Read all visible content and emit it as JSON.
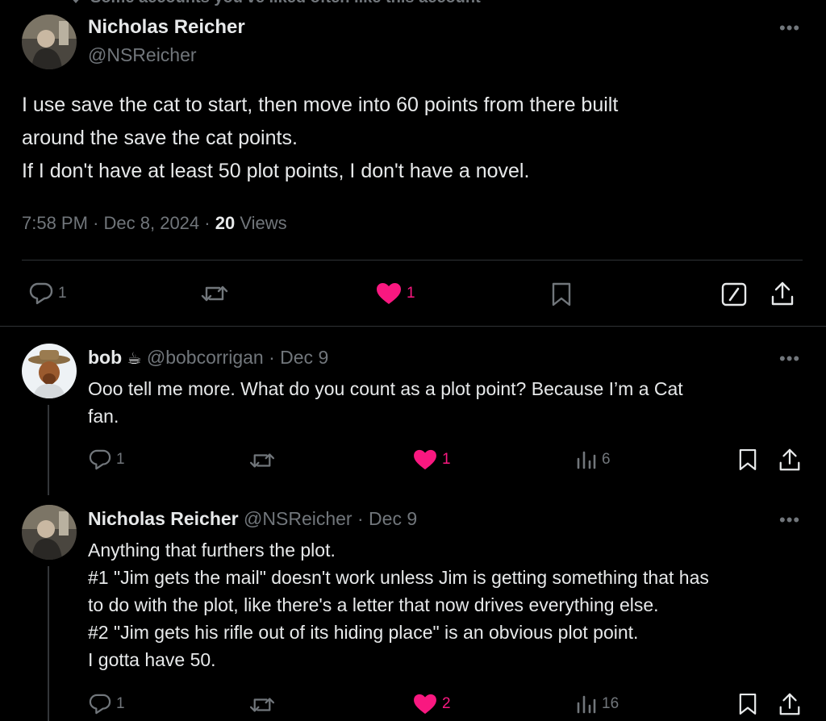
{
  "social_context": {
    "text": "Some accounts you've liked often like this account"
  },
  "main_post": {
    "author_name": "Nicholas Reicher",
    "handle": "@NSReicher",
    "text": "I use save the cat to start, then move into 60 points from there built\naround the save the cat points.\nIf I don't have at least 50 plot points, I don't have a novel.",
    "time": "7:58 PM",
    "date": "Dec 8, 2024",
    "views_count": "20",
    "views_label": "Views",
    "replies": "1",
    "likes": "1"
  },
  "replies": [
    {
      "author_name": "bob",
      "emoji": "☕",
      "handle": "@bobcorrigan",
      "date": "Dec 9",
      "text": "Ooo tell me more. What do you count as a plot point? Because I’m a Cat\nfan.",
      "replies": "1",
      "likes": "1",
      "views": "6"
    },
    {
      "author_name": "Nicholas Reicher",
      "handle": "@NSReicher",
      "date": "Dec 9",
      "text": "Anything that furthers the plot.\n#1 \"Jim gets the mail\" doesn't work unless Jim is getting something that has\nto do with the plot, like there's a letter that now drives everything else.\n#2 \"Jim gets his rifle out of its hiding place\" is an obvious plot point.\nI gotta have 50.",
      "replies": "1",
      "likes": "2",
      "views": "16"
    }
  ],
  "ui": {
    "more": "•••",
    "dot": "·"
  },
  "colors": {
    "background": "#000000",
    "text": "#e7e9ea",
    "muted": "#71767b",
    "like": "#f91880",
    "divider": "#2f3336"
  }
}
